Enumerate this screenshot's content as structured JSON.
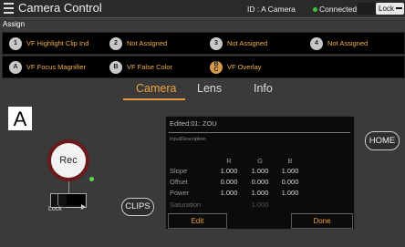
{
  "titlebar": {
    "app_title": "Camera Control",
    "camera_id": "ID : A Camera",
    "connection_status": "Connected",
    "connection_color": "#3cc43c",
    "lock_label": "Lock"
  },
  "assign": {
    "label": "Assign",
    "row1": [
      {
        "key": "1",
        "label": "VF Highlight Clip Ind"
      },
      {
        "key": "2",
        "label": "Not Assigned"
      },
      {
        "key": "3",
        "label": "Not Assigned"
      },
      {
        "key": "4",
        "label": "Not Assigned"
      }
    ],
    "row2": [
      {
        "key": "A",
        "label": "VF Focus Magnifier"
      },
      {
        "key": "B",
        "label": "VF False Color"
      },
      {
        "key_top": "B",
        "key_bottom": "C",
        "label": "VF Overlay"
      }
    ]
  },
  "tabs": {
    "camera": "Camera",
    "lens": "Lens",
    "info": "Info",
    "active": "Camera",
    "accent_color": "#f0a040"
  },
  "camera_letter": "A",
  "rec_label": "Rec",
  "lock_switch_label": "Lock",
  "clips_label": "CLIPS",
  "home_label": "HOME",
  "panel": {
    "title": "Edited:01: ZOU",
    "description": "InputDescription",
    "columns": [
      "R",
      "G",
      "B"
    ],
    "rows": [
      {
        "label": "Slope",
        "values": [
          "1.000",
          "1.000",
          "1.000"
        ]
      },
      {
        "label": "Offset",
        "values": [
          "0.000",
          "0.000",
          "0.000"
        ]
      },
      {
        "label": "Power",
        "values": [
          "1.000",
          "1.000",
          "1.000"
        ]
      }
    ],
    "saturation_label": "Saturation",
    "saturation_value": "1.000",
    "edit_label": "Edit",
    "done_label": "Done"
  }
}
